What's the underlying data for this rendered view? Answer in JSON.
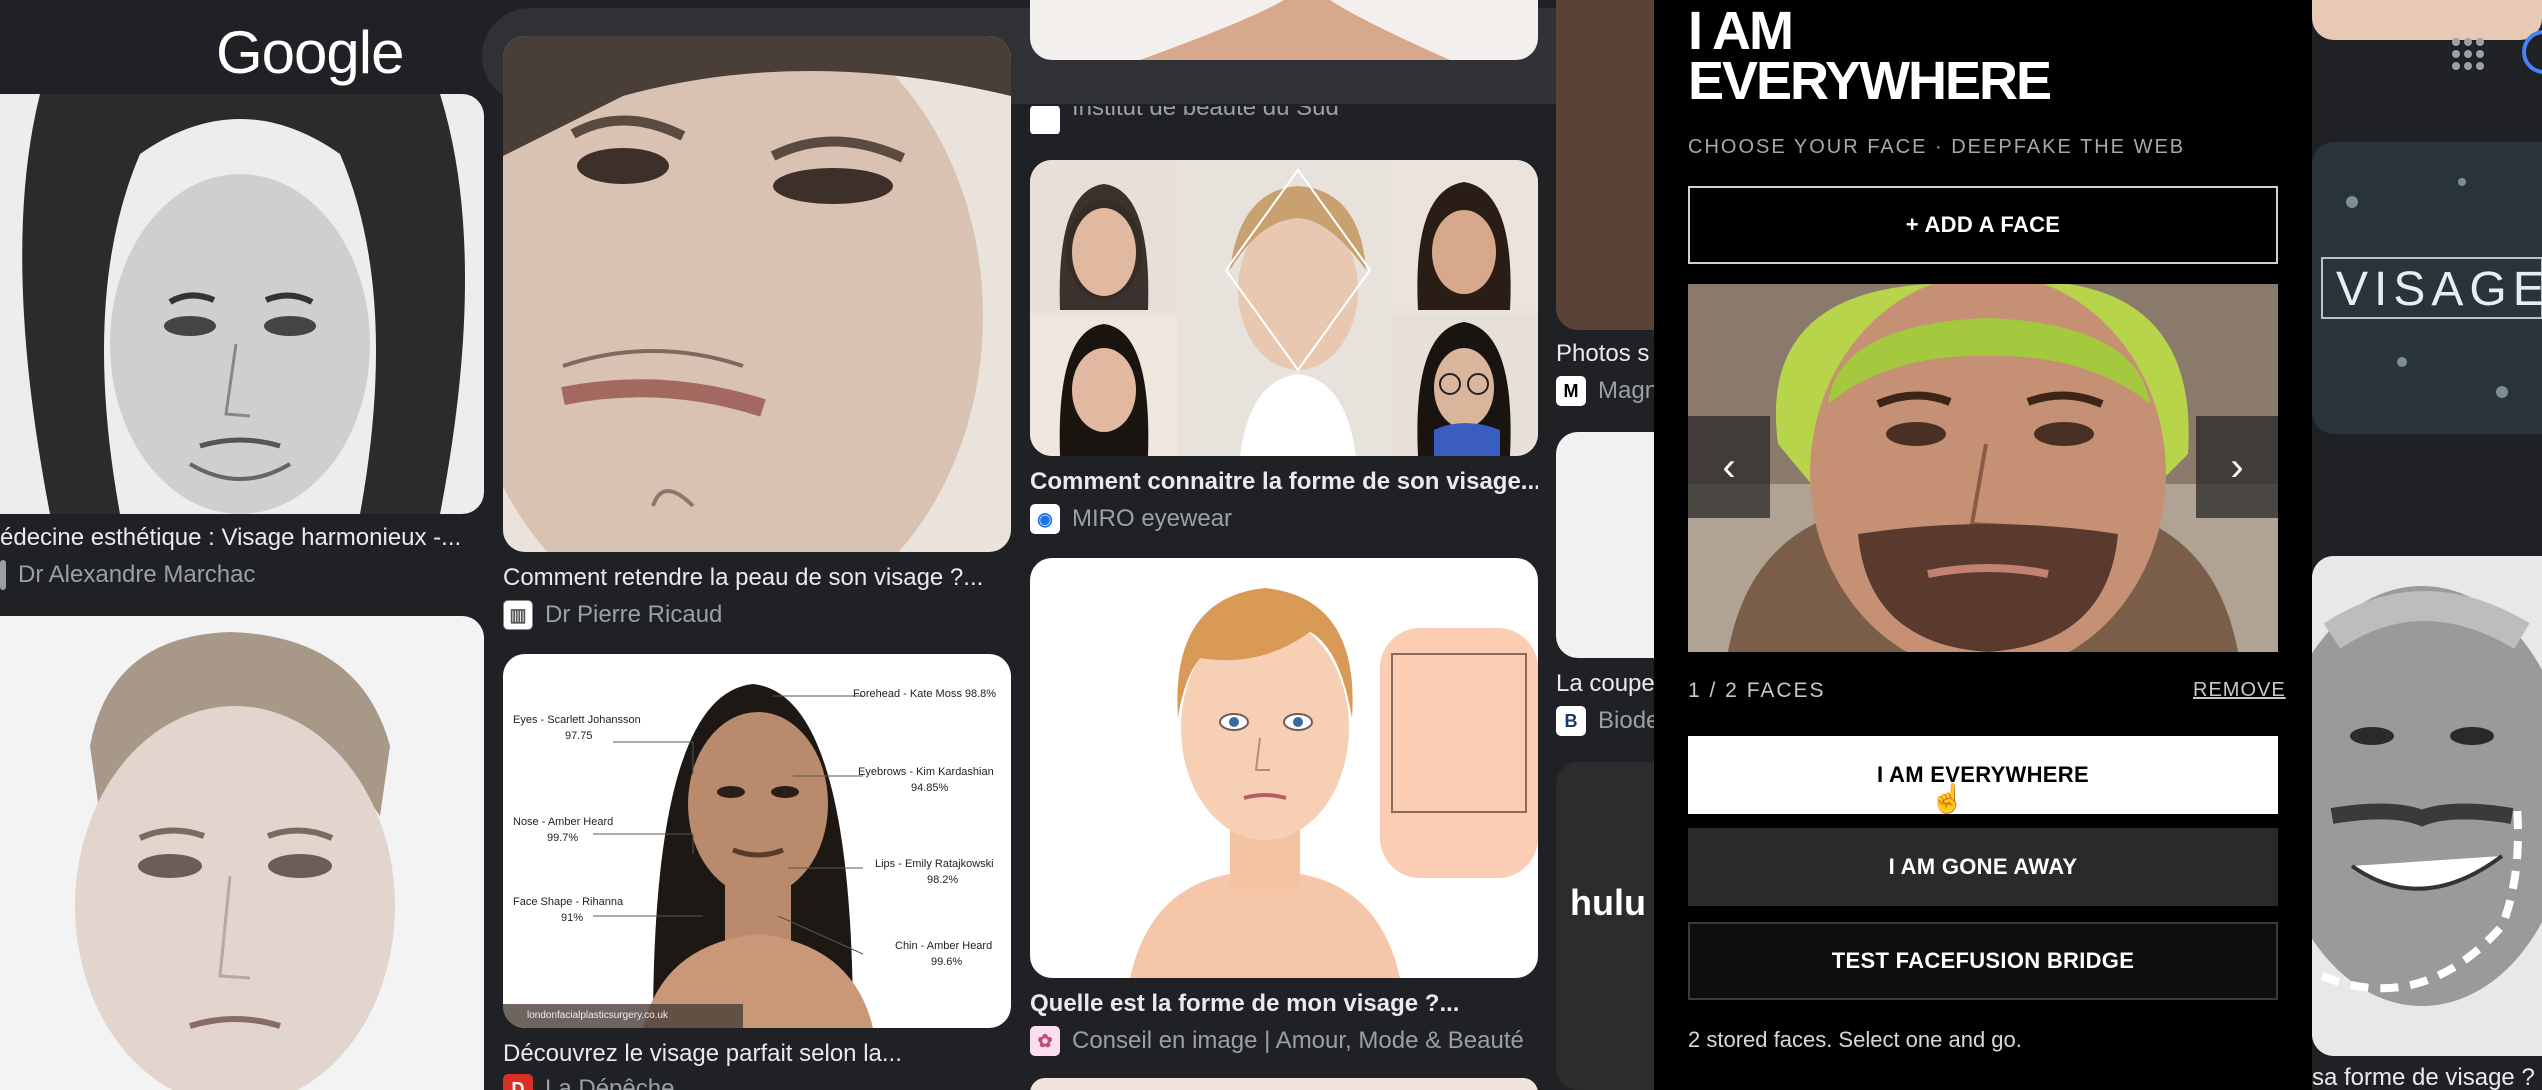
{
  "header": {
    "logo": "Google"
  },
  "results": {
    "col1": {
      "card1_caption": "édecine esthétique : Visage harmonieux -...",
      "card1_source": "Dr Alexandre Marchac"
    },
    "col2": {
      "card1_caption": "Comment retendre la peau de son visage ?...",
      "card1_source": "Dr Pierre Ricaud",
      "card2_labels": [
        "Forehead - Kate Moss 98.8%",
        "Eyes - Scarlett Johansson",
        "97.75",
        "Eyebrows - Kim Kardashian",
        "94.85%",
        "Nose - Amber Heard",
        "99.7%",
        "Lips - Emily Ratajkowski",
        "98.2%",
        "Face Shape - Rihanna",
        "91%",
        "Chin - Amber Heard",
        "99.6%"
      ],
      "card2_watermark": "londonfacialplasticsurgery.co.uk",
      "card2_caption": "Découvrez le visage parfait selon la...",
      "card2_source": "La Dépêche"
    },
    "col3": {
      "card0_source": "Institut de beauté du Sud",
      "card1_caption": "Comment connaitre la forme de son visage...",
      "card1_source": "MIRO eyewear",
      "card2_caption": "Quelle est la forme de mon visage ?...",
      "card2_source": "Conseil en image | Amour, Mode & Beauté"
    },
    "col4": {
      "card1_caption": "Photos s",
      "card1_source": "Magn",
      "card2_caption": "La coupe",
      "card2_source": "Biode",
      "card3_logo": "hulu"
    },
    "col5": {
      "card1_text": "VISAGE",
      "card2_caption": "sa forme de visage ?"
    }
  },
  "panel": {
    "title_line1": "I AM",
    "title_line2": "EVERYWHERE",
    "subtitle": "CHOOSE YOUR FACE · DEEPFAKE THE WEB",
    "add_face": "+ ADD A FACE",
    "prev": "‹",
    "next": "›",
    "counter": "1 / 2 FACES",
    "remove": "REMOVE",
    "btn_everywhere": "I AM EVERYWHERE",
    "btn_gone": "I AM GONE AWAY",
    "btn_test": "TEST FACEFUSION BRIDGE",
    "status": "2 stored faces. Select one and go."
  },
  "colors": {
    "accent_white": "#ffffff",
    "panel_bg": "#000000",
    "page_bg": "#202124"
  }
}
